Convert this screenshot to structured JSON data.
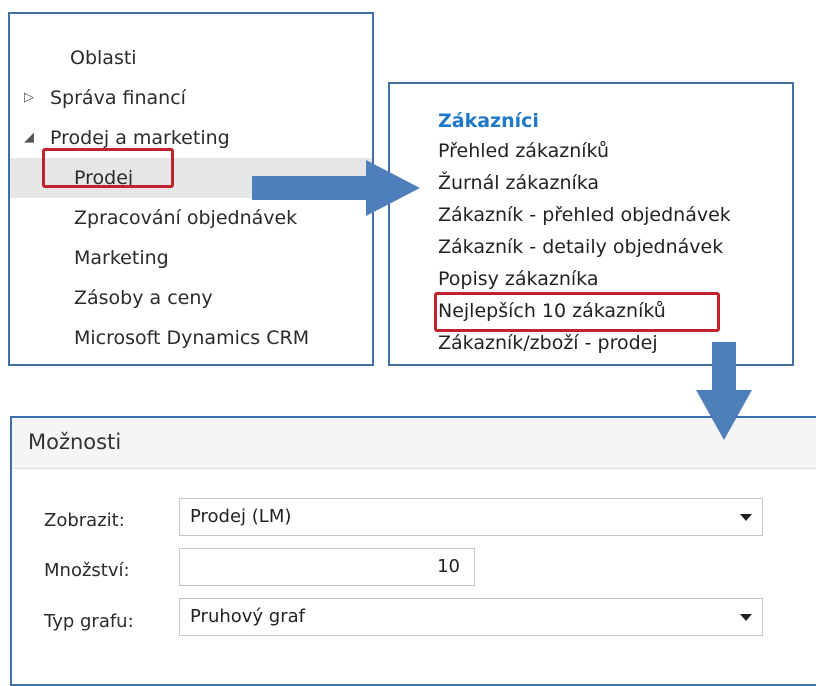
{
  "nav": {
    "items": [
      {
        "label": "Oblasti",
        "expander": ""
      },
      {
        "label": "Správa financí",
        "expander": "▷"
      },
      {
        "label": "Prodej a marketing",
        "expander": "◢"
      },
      {
        "label": "Prodej",
        "expander": ""
      },
      {
        "label": "Zpracování objednávek",
        "expander": ""
      },
      {
        "label": "Marketing",
        "expander": ""
      },
      {
        "label": "Zásoby a ceny",
        "expander": ""
      },
      {
        "label": "Microsoft Dynamics CRM",
        "expander": ""
      }
    ],
    "selected_item": "Prodej"
  },
  "reports": {
    "title": "Zákazníci",
    "items": [
      "Přehled zákazníků",
      "Žurnál zákazníka",
      "Zákazník - přehled objednávek",
      "Zákazník - detaily objednávek",
      "Popisy zákazníka",
      "Nejlepších 10 zákazníků",
      "Zákazník/zboží - prodej"
    ],
    "highlighted_item": "Nejlepších 10 zákazníků"
  },
  "options": {
    "title": "Možnosti",
    "fields": {
      "show": {
        "label": "Zobrazit:",
        "value": "Prodej (LM)"
      },
      "quantity": {
        "label": "Množství:",
        "value": "10"
      },
      "chart_type": {
        "label": "Typ grafu:",
        "value": "Pruhový graf"
      }
    }
  },
  "colors": {
    "panel_border": "#3f6fa8",
    "arrow": "#4f7fba",
    "highlight": "#c0232b",
    "report_title": "#1f78c8"
  },
  "icons": [
    "expand-arrow-icon",
    "collapse-arrow-icon",
    "dropdown-arrow-icon"
  ]
}
